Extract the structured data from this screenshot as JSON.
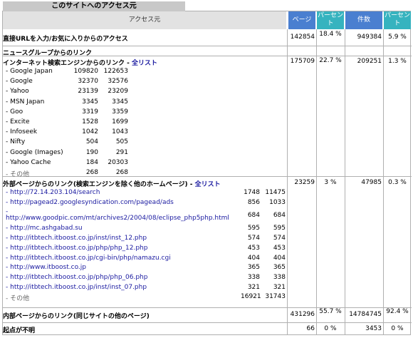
{
  "title": "このサイトへのアクセス元",
  "headers": {
    "source": "アクセス元",
    "page": "ページ",
    "percent1": "パーセント",
    "count": "件数",
    "percent2": "パーセント"
  },
  "direct": {
    "label": "直接URLを入力/お気に入りからのアクセス",
    "page": "142854",
    "pct1": "18.4 %",
    "count": "949384",
    "pct2": "5.9 %"
  },
  "news": {
    "label": "ニュースグループからのリンク"
  },
  "search": {
    "label": "インターネット検索エンジンからのリンク - ",
    "link": "全リスト",
    "page": "175709",
    "pct1": "22.7 %",
    "count": "209251",
    "pct2": "1.3 %",
    "engines": [
      {
        "name": "- Google Japan",
        "a": "109820",
        "b": "122653"
      },
      {
        "name": "- Google",
        "a": "32370",
        "b": "32576"
      },
      {
        "name": "- Yahoo",
        "a": "23139",
        "b": "23209"
      },
      {
        "name": "- MSN Japan",
        "a": "3345",
        "b": "3345"
      },
      {
        "name": "- Goo",
        "a": "3319",
        "b": "3359"
      },
      {
        "name": "- Excite",
        "a": "1528",
        "b": "1699"
      },
      {
        "name": "- Infoseek",
        "a": "1042",
        "b": "1043"
      },
      {
        "name": "- Nifty",
        "a": "504",
        "b": "505"
      },
      {
        "name": "- Google (Images)",
        "a": "190",
        "b": "291"
      },
      {
        "name": "- Yahoo Cache",
        "a": "184",
        "b": "20303"
      },
      {
        "name": "- その他",
        "a": "268",
        "b": "268"
      }
    ]
  },
  "external": {
    "label": "外部ページからのリンク(検索エンジンを除く他のホームページ) - ",
    "link": "全リスト",
    "page": "23259",
    "pct1": "3 %",
    "count": "47985",
    "pct2": "0.3 %",
    "links": [
      {
        "url": "- http://72.14.203.104/search",
        "a": "1748",
        "b": "11475"
      },
      {
        "url": "- http://pagead2.googlesyndication.com/pagead/ads",
        "a": "856",
        "b": "1033"
      },
      {
        "url": "-",
        "a": "684",
        "b": "684",
        "url2": "http://www.goodpic.com/mt/archives2/2004/08/eclipse_php5php.html"
      },
      {
        "url": "- http://mc.ashgabad.su",
        "a": "595",
        "b": "595"
      },
      {
        "url": "- http://itbtech.itboost.co.jp/inst/inst_12.php",
        "a": "574",
        "b": "574"
      },
      {
        "url": "- http://itbtech.itboost.co.jp/php/php_12.php",
        "a": "453",
        "b": "453"
      },
      {
        "url": "- http://itbtech.itboost.co.jp/cgi-bin/php/namazu.cgi",
        "a": "404",
        "b": "404"
      },
      {
        "url": "- http://www.itboost.co.jp",
        "a": "365",
        "b": "365"
      },
      {
        "url": "- http://itbtech.itboost.co.jp/php/php_06.php",
        "a": "338",
        "b": "338"
      },
      {
        "url": "- http://itbtech.itboost.co.jp/inst/inst_07.php",
        "a": "321",
        "b": "321"
      },
      {
        "url": "- その他",
        "a": "16921",
        "b": "31743"
      }
    ]
  },
  "internal": {
    "label": "内部ページからのリンク(同じサイトの他のページ)",
    "page": "431296",
    "pct1": "55.7 %",
    "count": "14784745",
    "pct2": "92.4 %"
  },
  "unknown": {
    "label": "起点が不明",
    "page": "66",
    "pct1": "0 %",
    "count": "3453",
    "pct2": "0 %"
  },
  "colors": {
    "blue": "#4a7fd0",
    "teal": "#36b3bf",
    "gray": "#c8c8c8",
    "link": "#1a1aa0"
  }
}
